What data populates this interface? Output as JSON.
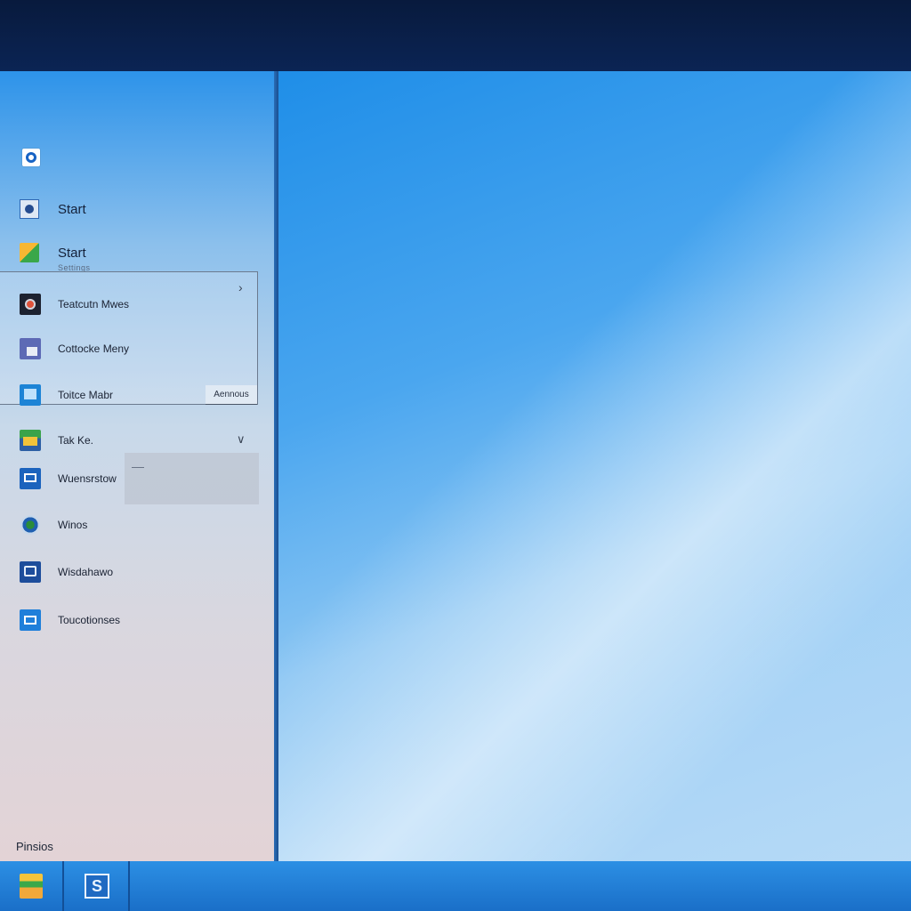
{
  "start_menu": {
    "top_items": [
      {
        "label": "Start",
        "icon": "start-icon"
      },
      {
        "label": "Start",
        "icon": "folder-icon"
      }
    ],
    "sublabel": "Settings",
    "popup": {
      "items": [
        {
          "label": "Teatcutn Mwes",
          "icon": "record-icon"
        },
        {
          "label": "Cottocke Meny",
          "icon": "picture-icon"
        },
        {
          "label": "Toitce Mabr",
          "icon": "window-icon"
        },
        {
          "label": "Tak Ke.",
          "icon": "gallery-icon"
        },
        {
          "label": "Wuensrstow",
          "icon": "monitor-icon"
        },
        {
          "label": "Winos",
          "icon": "globe-icon"
        },
        {
          "label": "Wisdahawo",
          "icon": "chat-icon"
        },
        {
          "label": "Toucotionses",
          "icon": "display-icon"
        }
      ],
      "annotate_label": "Aennous"
    },
    "bottom_label": "Pinsios"
  },
  "taskbar": {
    "items": [
      {
        "icon": "file-explorer-icon"
      },
      {
        "icon": "s-app-icon",
        "glyph": "S"
      }
    ]
  },
  "colors": {
    "accent": "#1f8ee8",
    "taskbar": "#1a6fc8",
    "topbar": "#081a3d"
  }
}
